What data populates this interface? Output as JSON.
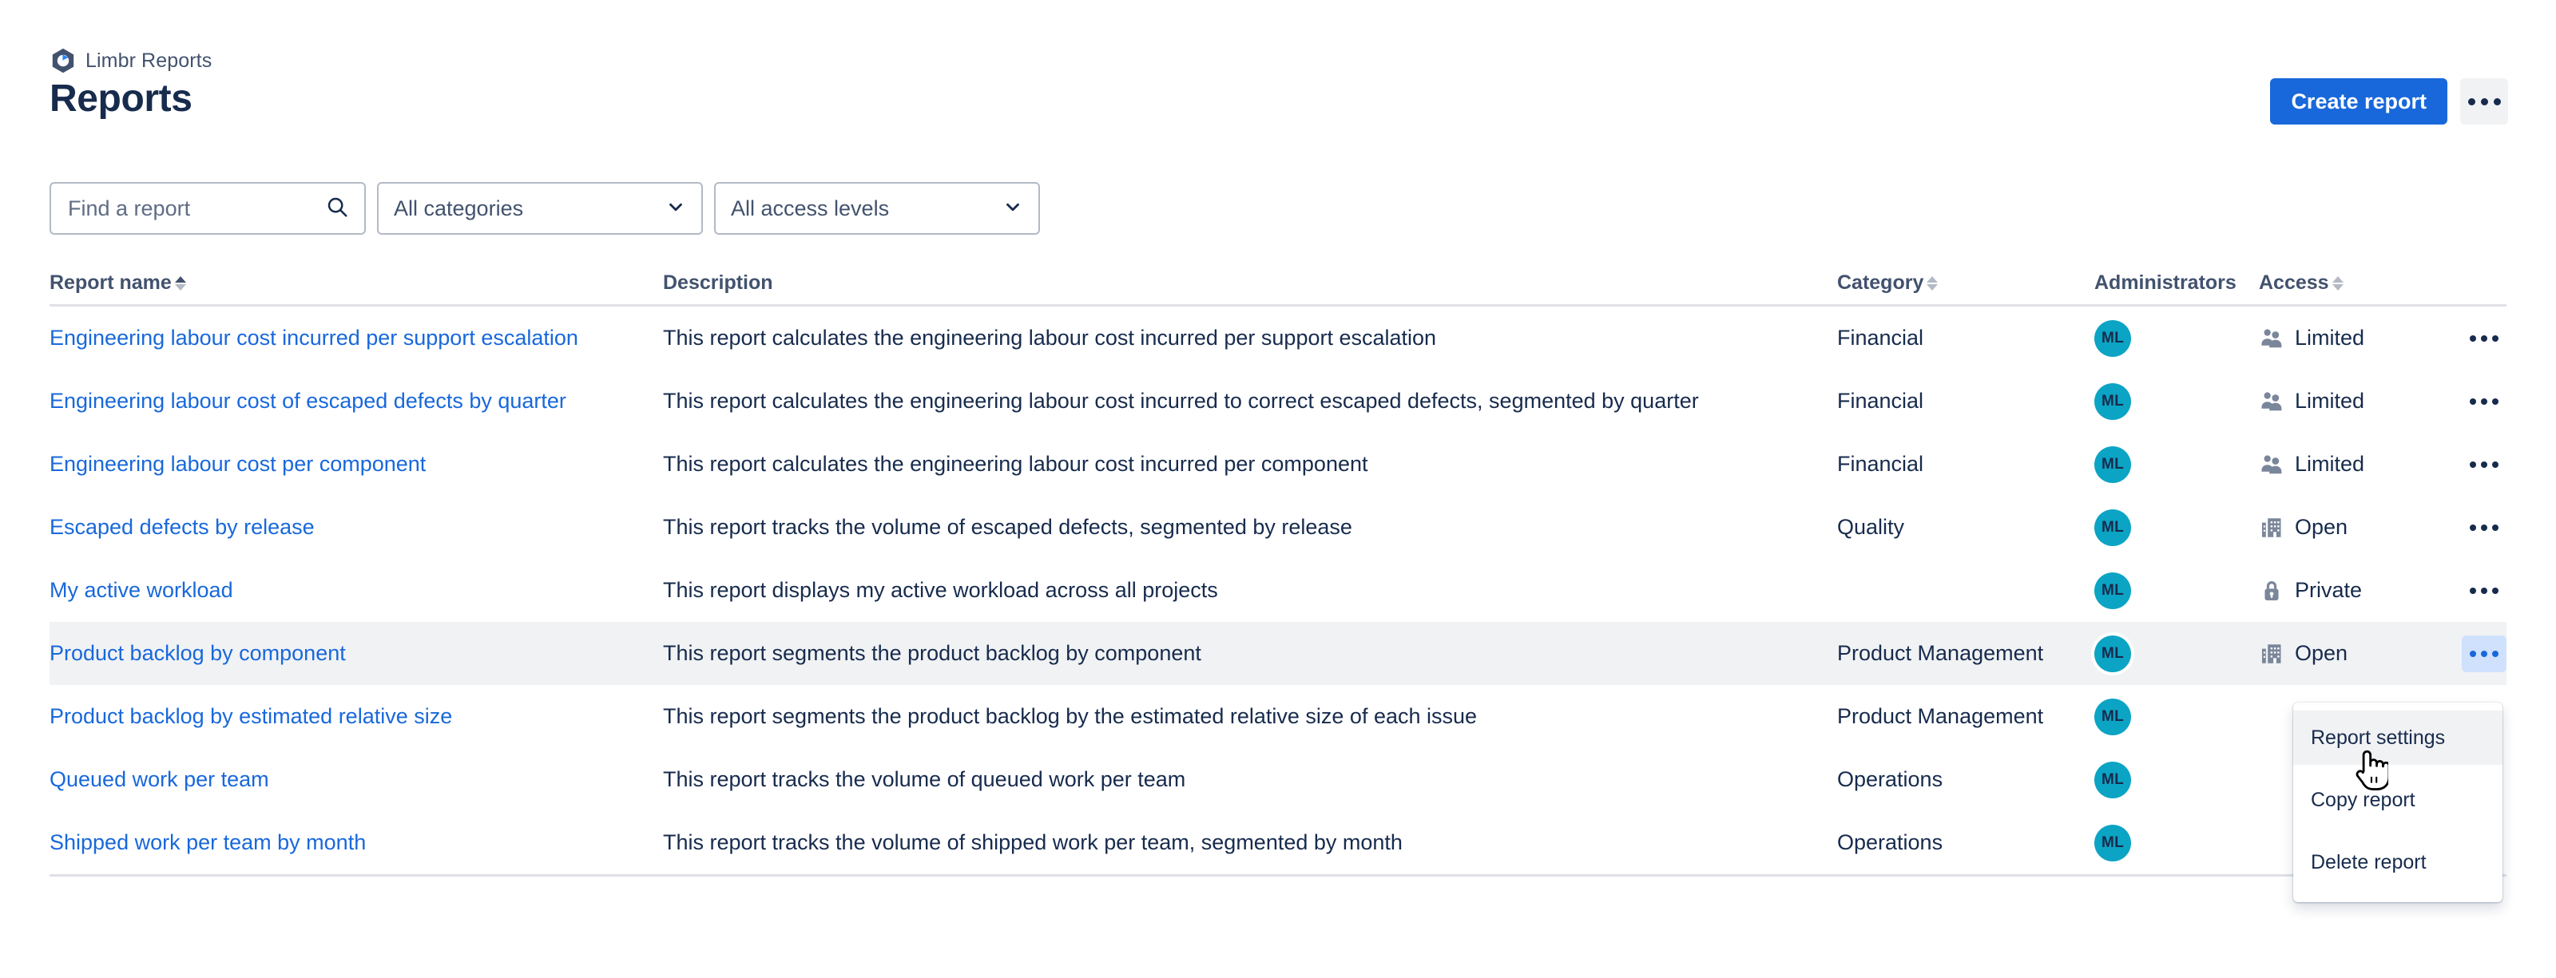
{
  "app": {
    "brand_name": "Limbr Reports",
    "brand_logo_icon": "limbr-hexagon-logo",
    "page_title": "Reports"
  },
  "header": {
    "create_button_label": "Create report",
    "more_button_icon": "more-horizontal-icon"
  },
  "filters": {
    "search_placeholder": "Find a report",
    "search_value": "",
    "search_icon": "search-icon",
    "category_select_value": "All categories",
    "access_select_value": "All access levels",
    "chevron_icon": "chevron-down-icon"
  },
  "table": {
    "columns": [
      {
        "key": "name",
        "label": "Report name",
        "sortable": true,
        "sort_state": "asc"
      },
      {
        "key": "desc",
        "label": "Description",
        "sortable": false,
        "sort_state": "none"
      },
      {
        "key": "cat",
        "label": "Category",
        "sortable": true,
        "sort_state": "none"
      },
      {
        "key": "admin",
        "label": "Administrators",
        "sortable": false,
        "sort_state": "none"
      },
      {
        "key": "acc",
        "label": "Access",
        "sortable": true,
        "sort_state": "none"
      }
    ],
    "rows": [
      {
        "name": "Engineering labour cost incurred per support escalation",
        "description": "This report calculates the engineering labour cost incurred per support escalation",
        "category": "Financial",
        "administrators": [
          "ML"
        ],
        "access": "Limited",
        "access_icon": "people-icon",
        "selected": false
      },
      {
        "name": "Engineering labour cost of escaped defects by quarter",
        "description": "This report calculates the engineering labour cost incurred to correct escaped defects, segmented by quarter",
        "category": "Financial",
        "administrators": [
          "ML"
        ],
        "access": "Limited",
        "access_icon": "people-icon",
        "selected": false
      },
      {
        "name": "Engineering labour cost per component",
        "description": "This report calculates the engineering labour cost incurred per component",
        "category": "Financial",
        "administrators": [
          "ML"
        ],
        "access": "Limited",
        "access_icon": "people-icon",
        "selected": false
      },
      {
        "name": "Escaped defects by release",
        "description": "This report tracks the volume of escaped defects, segmented by release",
        "category": "Quality",
        "administrators": [
          "ML"
        ],
        "access": "Open",
        "access_icon": "building-icon",
        "selected": false
      },
      {
        "name": "My active workload",
        "description": "This report displays my active workload across all projects",
        "category": "",
        "administrators": [
          "ML"
        ],
        "access": "Private",
        "access_icon": "lock-icon",
        "selected": false
      },
      {
        "name": "Product backlog by component",
        "description": "This report segments the product backlog by component",
        "category": "Product Management",
        "administrators": [
          "ML"
        ],
        "access": "Open",
        "access_icon": "building-icon",
        "selected": true
      },
      {
        "name": "Product backlog by estimated relative size",
        "description": "This report segments the product backlog by the estimated relative size of each issue",
        "category": "Product Management",
        "administrators": [
          "ML"
        ],
        "access": "",
        "access_icon": "",
        "selected": false
      },
      {
        "name": "Queued work per team",
        "description": "This report tracks the volume of queued work per team",
        "category": "Operations",
        "administrators": [
          "ML"
        ],
        "access": "",
        "access_icon": "",
        "selected": false
      },
      {
        "name": "Shipped work per team by month",
        "description": "This report tracks the volume of shipped work per team, segmented by month",
        "category": "Operations",
        "administrators": [
          "ML"
        ],
        "access": "",
        "access_icon": "",
        "selected": false
      }
    ],
    "row_more_icon": "more-horizontal-icon"
  },
  "context_menu": {
    "open": true,
    "items": [
      {
        "label": "Report settings",
        "hovered": true
      },
      {
        "label": "Copy report",
        "hovered": false
      },
      {
        "label": "Delete report",
        "hovered": false
      }
    ]
  },
  "cursor": {
    "icon": "pointing-hand-cursor"
  },
  "colors": {
    "brand_blue": "#1868DB",
    "link_blue": "#1868DB",
    "text_dark": "#172B4D",
    "text_muted": "#42526E",
    "avatar_teal": "#0BA4C4",
    "row_selected_bg": "#F1F2F4",
    "active_more_bg": "#CFE1FD",
    "border_grey": "#DFE1E6"
  }
}
